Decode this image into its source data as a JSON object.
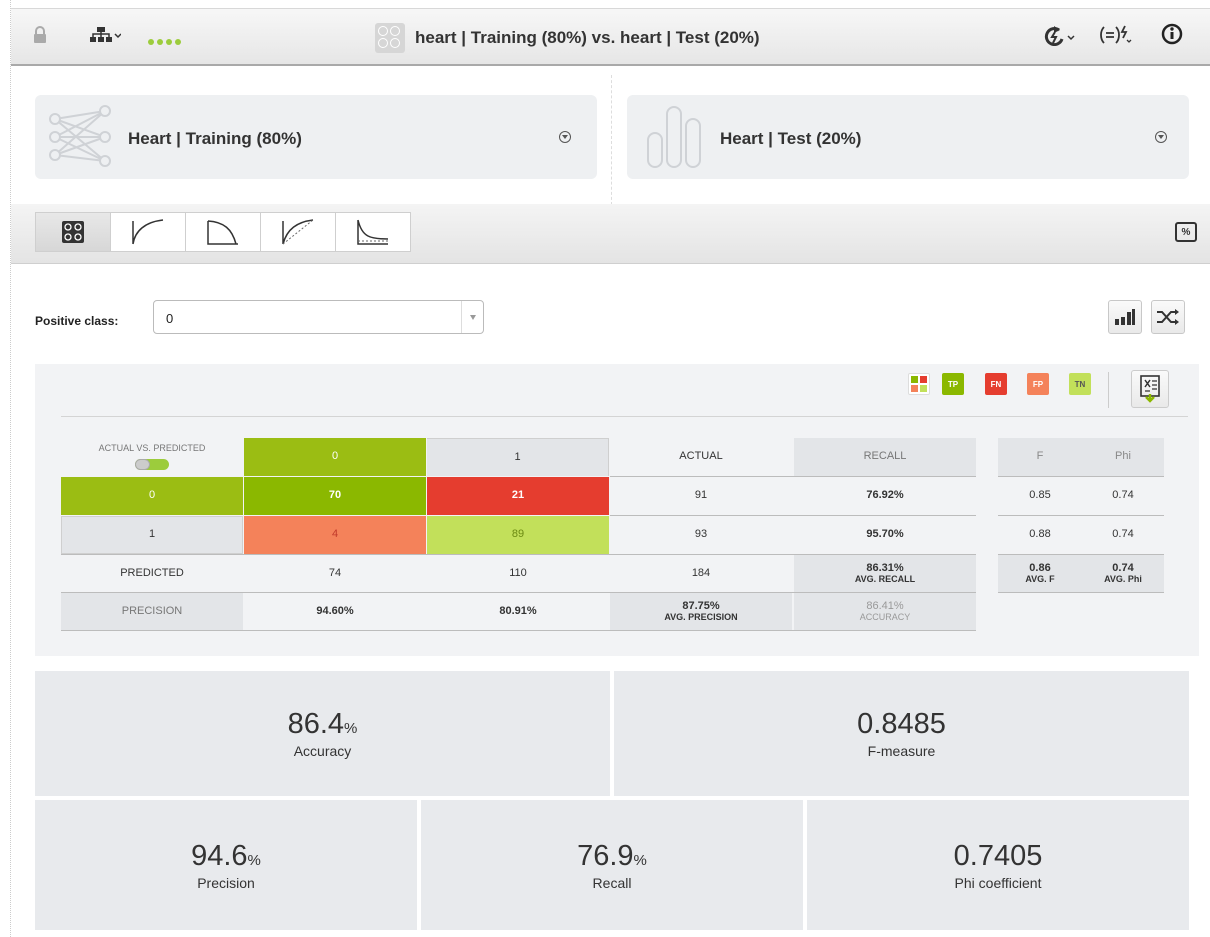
{
  "header": {
    "title": "heart | Training (80%) vs. heart | Test (20%)"
  },
  "model_card": {
    "label": "Heart | Training (80%)"
  },
  "dataset_card": {
    "label": "Heart | Test (20%)"
  },
  "positive_class": {
    "label": "Positive class:",
    "value": "0"
  },
  "legend": {
    "tp": "TP",
    "fn": "FN",
    "fp": "FP",
    "tn": "TN"
  },
  "matrix": {
    "corner_label": "ACTUAL VS. PREDICTED",
    "col_headers": [
      "0",
      "1"
    ],
    "actual_header": "ACTUAL",
    "recall_header": "RECALL",
    "rows": [
      {
        "label": "0",
        "cells": [
          "70",
          "21"
        ],
        "actual": "91",
        "recall": "76.92%"
      },
      {
        "label": "1",
        "cells": [
          "4",
          "89"
        ],
        "actual": "93",
        "recall": "95.70%"
      }
    ],
    "predicted_label": "PREDICTED",
    "predicted_totals": [
      "74",
      "110"
    ],
    "grand_total": "184",
    "avg_recall": {
      "value": "86.31%",
      "label": "AVG. RECALL"
    },
    "precision_label": "PRECISION",
    "precision_values": [
      "94.60%",
      "80.91%"
    ],
    "avg_precision": {
      "value": "87.75%",
      "label": "AVG. PRECISION"
    },
    "accuracy": {
      "value": "86.41%",
      "label": "ACCURACY"
    }
  },
  "side_table": {
    "headers": [
      "F",
      "Phi"
    ],
    "rows": [
      [
        "0.85",
        "0.74"
      ],
      [
        "0.88",
        "0.74"
      ]
    ],
    "avg_f": {
      "value": "0.86",
      "label": "AVG. F"
    },
    "avg_phi": {
      "value": "0.74",
      "label": "AVG. Phi"
    }
  },
  "metrics": {
    "accuracy": {
      "value": "86.4",
      "unit": "%",
      "label": "Accuracy"
    },
    "f_measure": {
      "value": "0.8485",
      "unit": "",
      "label": "F-measure"
    },
    "precision": {
      "value": "94.6",
      "unit": "%",
      "label": "Precision"
    },
    "recall": {
      "value": "76.9",
      "unit": "%",
      "label": "Recall"
    },
    "phi": {
      "value": "0.7405",
      "unit": "",
      "label": "Phi coefficient"
    }
  },
  "colors": {
    "tp": "#8bb800",
    "fn": "#e53d2f",
    "fp": "#f4825a",
    "tn": "#c2e05a",
    "header_bg": "#e6e6e6",
    "metric_bg": "#e8eaed"
  },
  "icons": [
    "lock-icon",
    "hierarchy-icon",
    "status-dots-icon",
    "evaluation-icon",
    "refresh-icon",
    "formula-icon",
    "info-icon",
    "model-icon",
    "dataset-icon",
    "chevron-down-icon",
    "confusion-matrix-icon",
    "roc-curve-icon",
    "precision-recall-icon",
    "gain-curve-icon",
    "lift-curve-icon",
    "percent-icon",
    "bar-chart-icon",
    "shuffle-icon",
    "export-excel-icon"
  ]
}
